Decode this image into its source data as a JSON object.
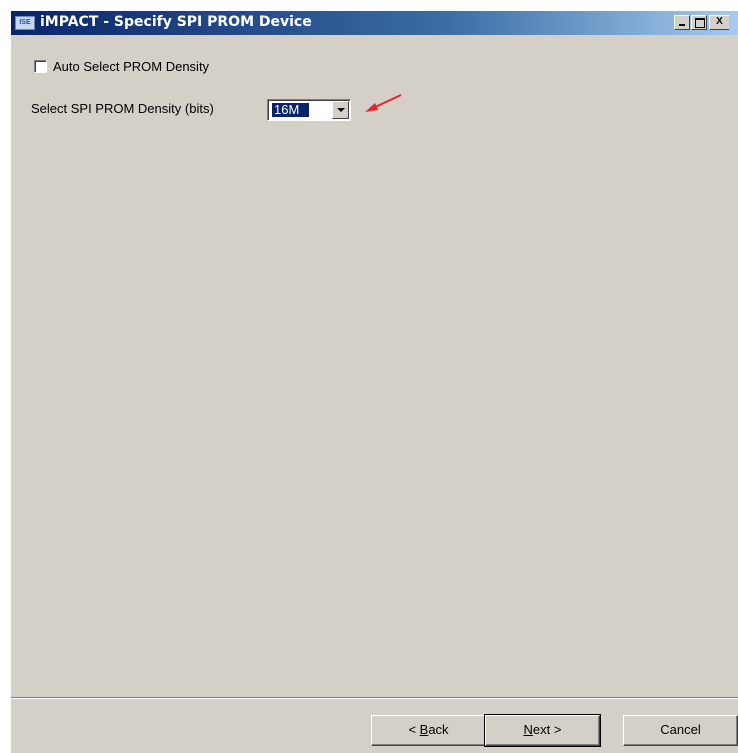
{
  "window": {
    "icon_text": "ISE",
    "title": "iMPACT - Specify SPI PROM Device",
    "controls": {
      "close_glyph": "X"
    }
  },
  "form": {
    "auto_select_label": "Auto Select PROM Density",
    "auto_select_checked": false,
    "density_label": "Select SPI PROM Density (bits)",
    "density_value": "16M"
  },
  "annotation": {
    "arrow_color": "#e8232d"
  },
  "buttons": {
    "back": {
      "prefix": "< ",
      "accel": "B",
      "rest": "ack"
    },
    "next": {
      "accel": "N",
      "rest": "ext >"
    },
    "cancel": "Cancel"
  },
  "colors": {
    "face": "#d4d0c8",
    "titlebar_start": "#0a246a",
    "titlebar_end": "#a6caf0",
    "selection": "#0a246a"
  }
}
